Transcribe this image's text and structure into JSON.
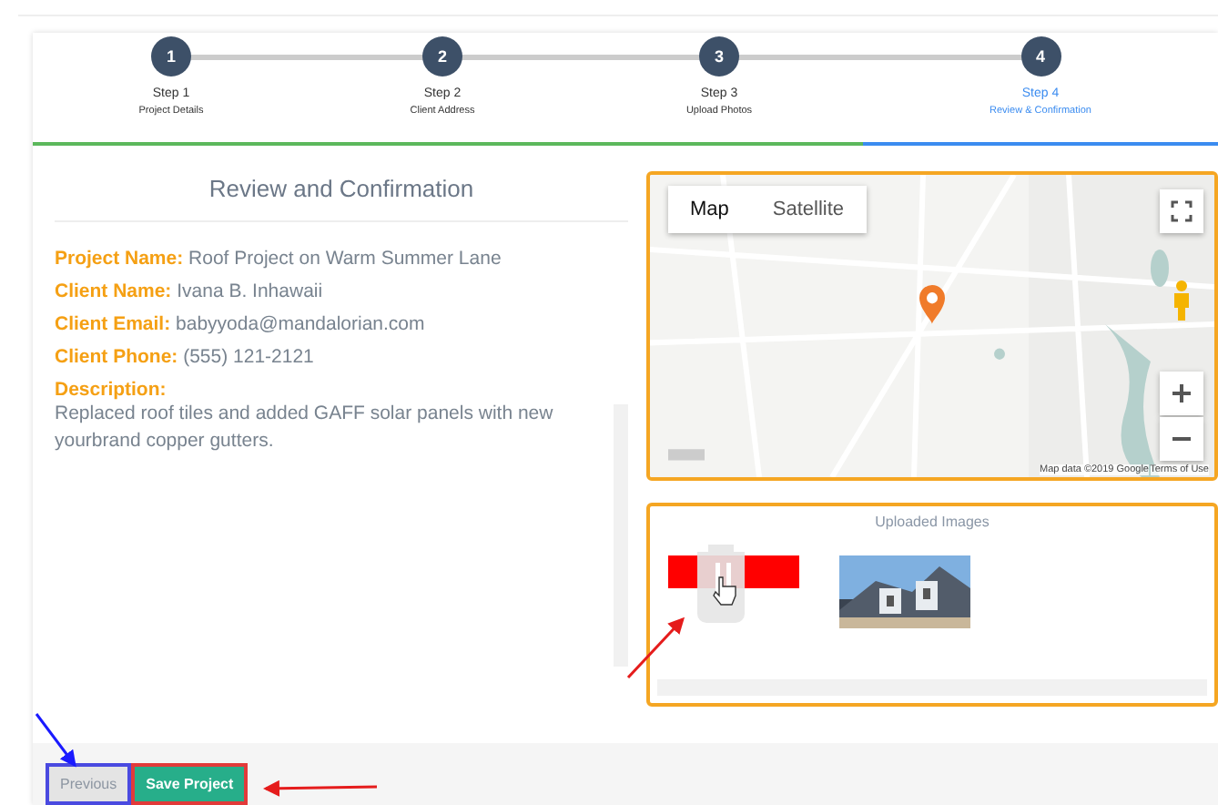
{
  "steps": [
    {
      "number": "1",
      "title": "Step 1",
      "subtitle": "Project Details",
      "selected": false
    },
    {
      "number": "2",
      "title": "Step 2",
      "subtitle": "Client Address",
      "selected": false
    },
    {
      "number": "3",
      "title": "Step 3",
      "subtitle": "Upload Photos",
      "selected": false
    },
    {
      "number": "4",
      "title": "Step 4",
      "subtitle": "Review & Confirmation",
      "selected": true
    }
  ],
  "review": {
    "title": "Review and Confirmation",
    "fields": [
      {
        "label": "Project Name:",
        "value": "Roof Project on Warm Summer Lane"
      },
      {
        "label": "Client Name:",
        "value": "Ivana B. Inhawaii"
      },
      {
        "label": "Client Email:",
        "value": "babyyoda@mandalorian.com"
      },
      {
        "label": "Client Phone:",
        "value": "(555) 121-2121"
      }
    ],
    "description": {
      "label": "Description:",
      "value": "Replaced roof tiles and added GAFF solar panels with new yourbrand copper gutters."
    }
  },
  "map": {
    "types": [
      {
        "label": "Map",
        "selected": true
      },
      {
        "label": "Satellite",
        "selected": false
      }
    ],
    "attribution": "Map data ©2019 Google",
    "terms": "Terms of Use"
  },
  "uploads": {
    "title": "Uploaded Images",
    "images": [
      {
        "kind": "deleting"
      },
      {
        "kind": "picture"
      }
    ]
  },
  "actions": [
    {
      "label": "Previous",
      "kind": "secondary"
    },
    {
      "label": "Save Project",
      "kind": "primary"
    }
  ]
}
